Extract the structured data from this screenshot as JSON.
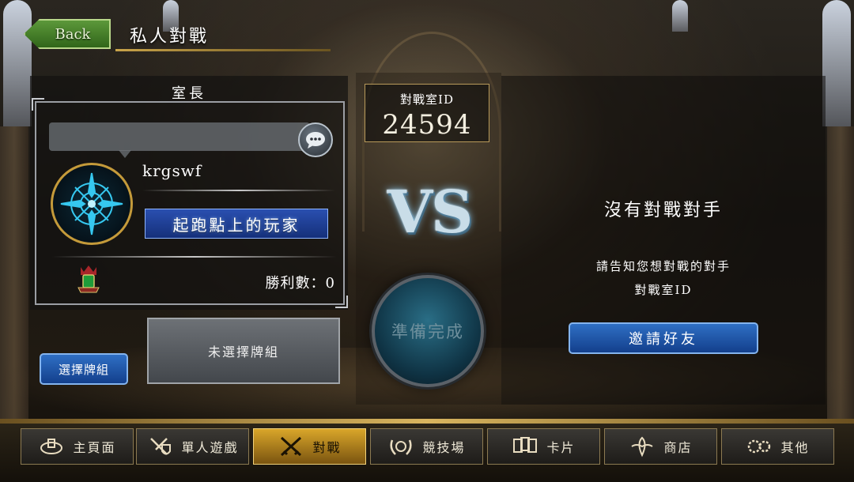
{
  "header": {
    "back_label": "Back",
    "title": "私人對戰"
  },
  "host_panel": {
    "title": "室長",
    "player_name": "krgswf",
    "player_title": "起跑點上的玩家",
    "wins_label": "勝利數：0",
    "deck_button": "選擇牌組",
    "deck_slot": "未選擇牌組"
  },
  "center": {
    "room_label": "對戰室ID",
    "room_id": "24594",
    "vs_text": "VS",
    "ready_button": "準備完成"
  },
  "opponent_panel": {
    "status": "沒有對戰對手",
    "hint_line1": "請告知您想對戰的對手",
    "hint_line2": "對戰室ID",
    "invite_button": "邀請好友"
  },
  "nav": {
    "items": [
      {
        "label": "主頁面",
        "icon": "home-icon"
      },
      {
        "label": "單人遊戲",
        "icon": "swords-shield-icon"
      },
      {
        "label": "對戰",
        "icon": "crossed-swords-icon",
        "active": true
      },
      {
        "label": "競技場",
        "icon": "laurel-icon"
      },
      {
        "label": "卡片",
        "icon": "cards-icon"
      },
      {
        "label": "商店",
        "icon": "shop-icon"
      },
      {
        "label": "其他",
        "icon": "gears-icon"
      }
    ]
  },
  "colors": {
    "accent_gold": "#d9a62a",
    "button_blue": "#2f6fc4",
    "back_green": "#5f9b3c"
  }
}
